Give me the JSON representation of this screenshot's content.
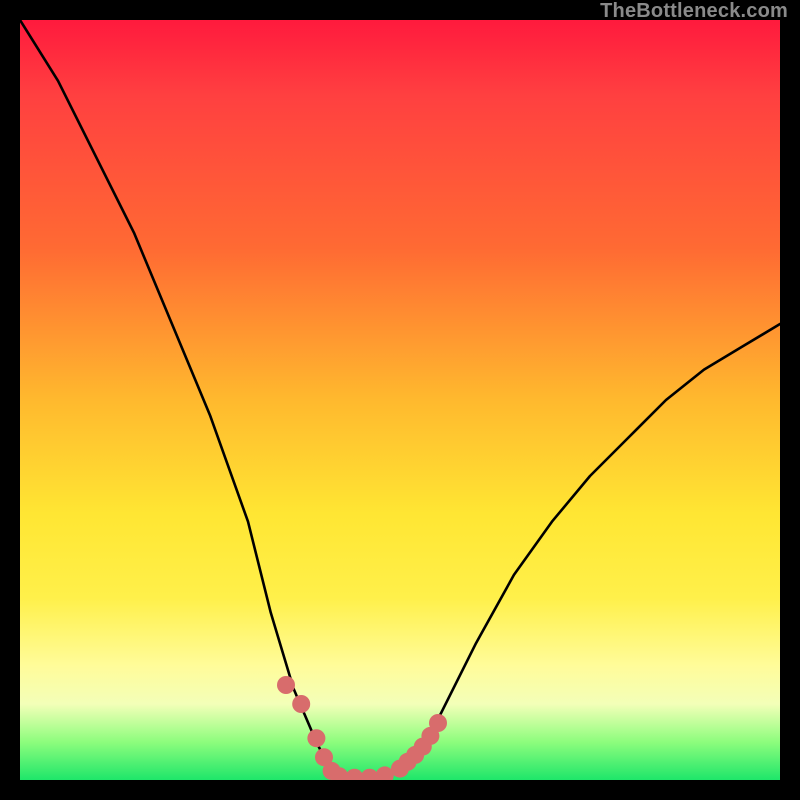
{
  "watermark": "TheBottleneck.com",
  "chart_data": {
    "type": "line",
    "title": "",
    "xlabel": "",
    "ylabel": "",
    "xlim": [
      0,
      100
    ],
    "ylim": [
      0,
      100
    ],
    "grid": false,
    "series": [
      {
        "name": "bottleneck-curve",
        "color": "#000000",
        "x": [
          0,
          5,
          10,
          15,
          20,
          25,
          30,
          33,
          36,
          39,
          40,
          41,
          42,
          44,
          46,
          49,
          52,
          55,
          60,
          65,
          70,
          75,
          80,
          85,
          90,
          95,
          100
        ],
        "values": [
          100,
          92,
          82,
          72,
          60,
          48,
          34,
          22,
          12,
          5,
          3,
          1,
          0,
          0,
          0,
          1,
          3,
          8,
          18,
          27,
          34,
          40,
          45,
          50,
          54,
          57,
          60
        ]
      },
      {
        "name": "highlight-markers",
        "color": "#d86c6c",
        "x": [
          35,
          37,
          39,
          40,
          41,
          42,
          44,
          46,
          48,
          50,
          51,
          52,
          53,
          54,
          55
        ],
        "values": [
          12.5,
          10,
          5.5,
          3,
          1.2,
          0.5,
          0.3,
          0.3,
          0.6,
          1.5,
          2.4,
          3.3,
          4.4,
          5.8,
          7.5
        ]
      }
    ],
    "gradient_stops": [
      {
        "pos": 0,
        "color": "#ff1a3d"
      },
      {
        "pos": 10,
        "color": "#ff4040"
      },
      {
        "pos": 30,
        "color": "#ff6a33"
      },
      {
        "pos": 50,
        "color": "#ffb92e"
      },
      {
        "pos": 65,
        "color": "#ffe633"
      },
      {
        "pos": 76,
        "color": "#fff04a"
      },
      {
        "pos": 85,
        "color": "#fffc9a"
      },
      {
        "pos": 90,
        "color": "#f3ffb8"
      },
      {
        "pos": 95,
        "color": "#8dfd7d"
      },
      {
        "pos": 100,
        "color": "#1ee66a"
      }
    ]
  }
}
